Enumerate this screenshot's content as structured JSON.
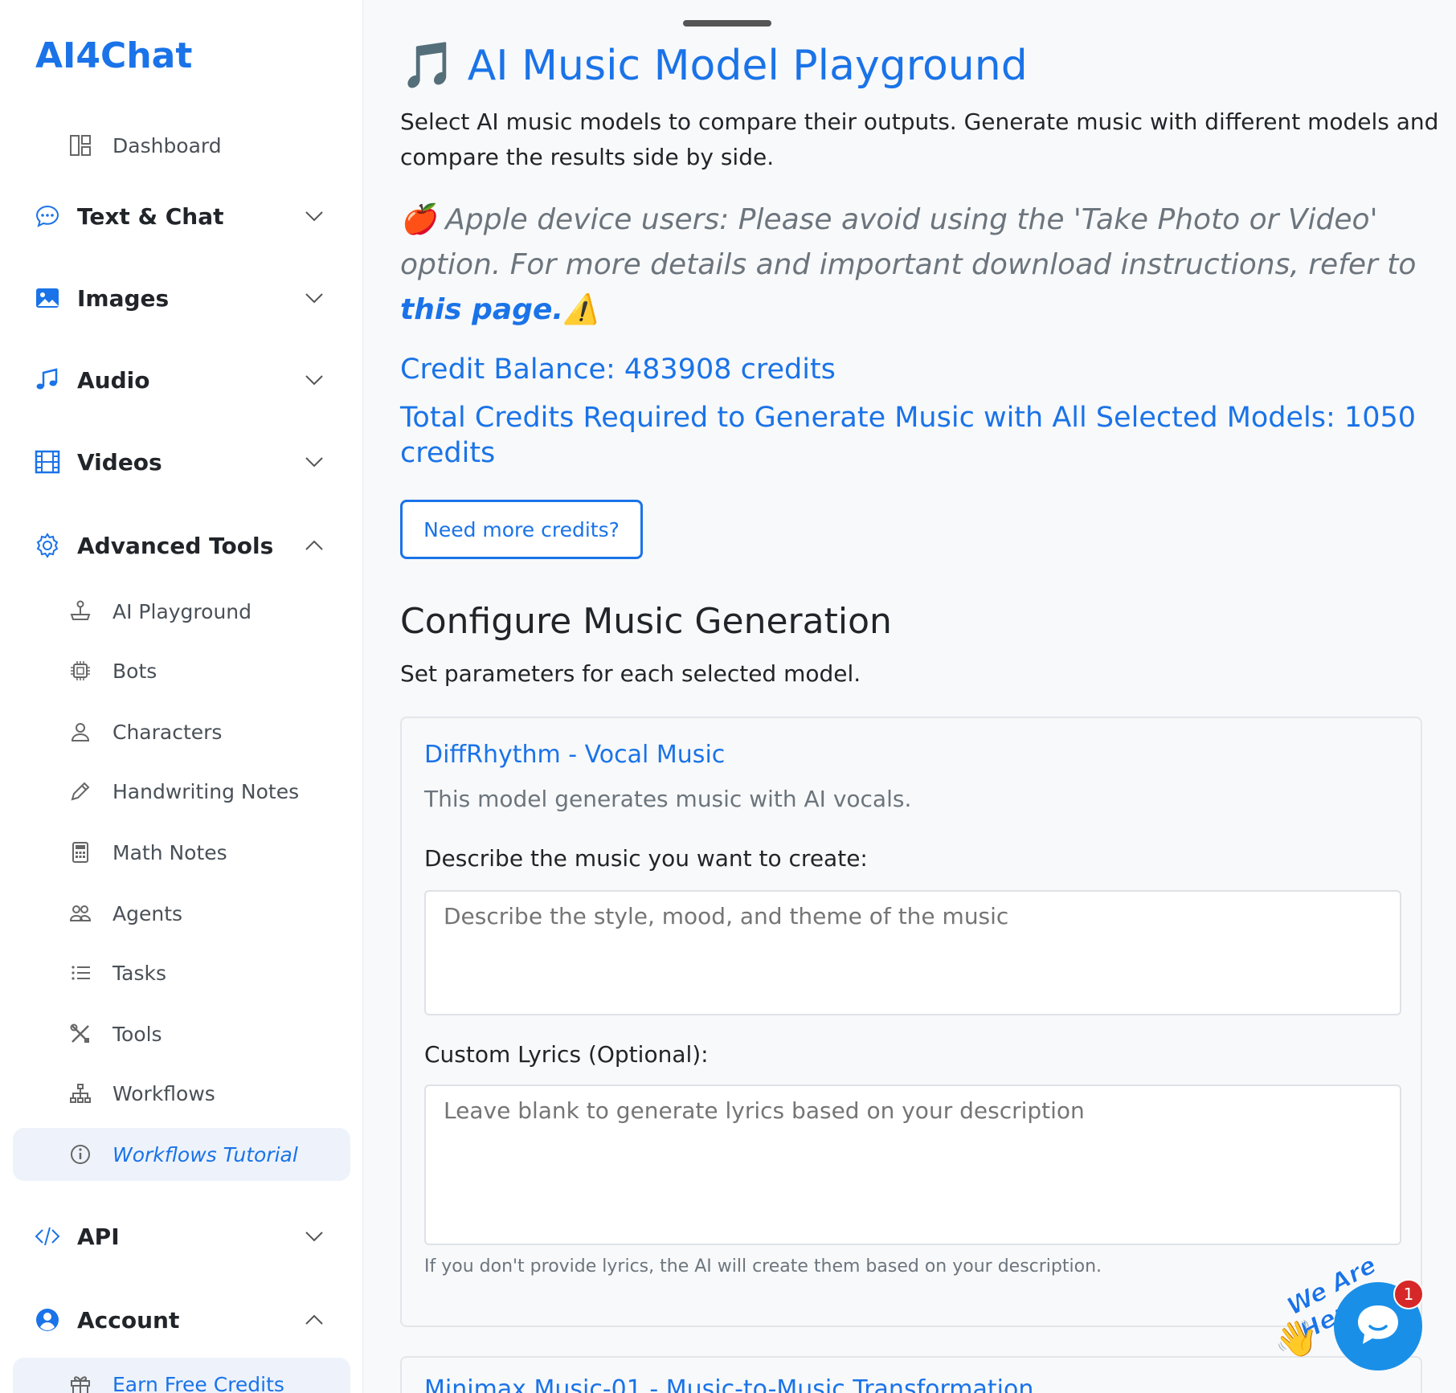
{
  "brand": "AI4Chat",
  "sidebar": {
    "dashboard": "Dashboard",
    "text_chat": "Text & Chat",
    "images": "Images",
    "audio": "Audio",
    "videos": "Videos",
    "advanced_tools": "Advanced Tools",
    "advanced_items": [
      {
        "label": "AI Playground",
        "icon": "joystick-icon"
      },
      {
        "label": "Bots",
        "icon": "cpu-icon"
      },
      {
        "label": "Characters",
        "icon": "person-icon"
      },
      {
        "label": "Handwriting Notes",
        "icon": "pencil-icon"
      },
      {
        "label": "Math Notes",
        "icon": "calculator-icon"
      },
      {
        "label": "Agents",
        "icon": "people-icon"
      },
      {
        "label": "Tasks",
        "icon": "list-icon"
      },
      {
        "label": "Tools",
        "icon": "tools-icon"
      },
      {
        "label": "Workflows",
        "icon": "diagram-icon"
      },
      {
        "label": "Workflows Tutorial",
        "icon": "info-icon"
      }
    ],
    "api": "API",
    "account": "Account",
    "earn": "Earn Free Credits"
  },
  "main": {
    "title_icon": "🎵",
    "title": "AI Music Model Playground",
    "intro": "Select AI music models to compare their outputs. Generate music with different models and compare the results side by side.",
    "apple_icon": "🍎",
    "apple_text": "Apple device users: Please avoid using the 'Take Photo or Video' option. For more details and important download instructions, refer to",
    "apple_link": "this page.",
    "apple_warn": "⚠️",
    "credit_balance": "Credit Balance: 483908 credits",
    "total_required": "Total Credits Required to Generate Music with All Selected Models: 1050 credits",
    "more_credits_button": "Need more credits?",
    "configure_title": "Configure Music Generation",
    "configure_sub": "Set parameters for each selected model.",
    "card1": {
      "title": "DiffRhythm - Vocal Music",
      "desc": "This model generates music with AI vocals.",
      "describe_label": "Describe the music you want to create:",
      "describe_placeholder": "Describe the style, mood, and theme of the music",
      "lyrics_label": "Custom Lyrics (Optional):",
      "lyrics_placeholder": "Leave blank to generate lyrics based on your description",
      "hint": "If you don't provide lyrics, the AI will create them based on your description."
    },
    "card2": {
      "title": "Minimax Music-01 - Music-to-Music Transformation"
    }
  },
  "chat_widget": {
    "tagline": "We Are Here!",
    "badge": "1",
    "wave": "👋"
  },
  "colors": {
    "accent": "#1a73e8",
    "badge": "#d62828"
  }
}
